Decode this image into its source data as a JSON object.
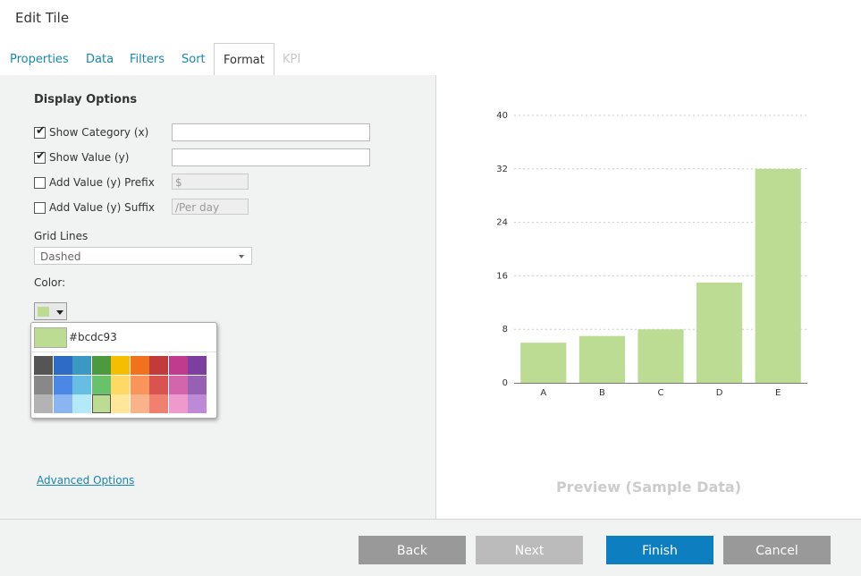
{
  "header": {
    "title": "Edit Tile"
  },
  "tabs": [
    {
      "label": "Properties",
      "state": "normal"
    },
    {
      "label": "Data",
      "state": "normal"
    },
    {
      "label": "Filters",
      "state": "normal"
    },
    {
      "label": "Sort",
      "state": "normal"
    },
    {
      "label": "Format",
      "state": "active"
    },
    {
      "label": "KPI",
      "state": "disabled"
    }
  ],
  "display_options": {
    "title": "Display Options",
    "show_category": {
      "label": "Show Category (x)",
      "checked": true,
      "value": ""
    },
    "show_value": {
      "label": "Show Value (y)",
      "checked": true,
      "value": ""
    },
    "prefix": {
      "label": "Add Value (y) Prefix",
      "checked": false,
      "placeholder": "$"
    },
    "suffix": {
      "label": "Add Value (y) Suffix",
      "checked": false,
      "placeholder": "/Per day"
    },
    "grid_lines_label": "Grid Lines",
    "grid_lines_value": "Dashed",
    "color_label": "Color:",
    "color_value": "#bcdc93",
    "advanced_label": "Advanced Options"
  },
  "palette": [
    [
      "#555555",
      "#2e6bc6",
      "#3a98c1",
      "#4b9a3d",
      "#f6be00",
      "#f2711c",
      "#c23a3a",
      "#c03b8e",
      "#7d3f9f"
    ],
    [
      "#888888",
      "#4d87e6",
      "#66bfe3",
      "#67c26b",
      "#ffd966",
      "#f9945a",
      "#d9534f",
      "#d265ac",
      "#9761b3"
    ],
    [
      "#b3b3b3",
      "#8ab4f2",
      "#b4eaf7",
      "#bcdc93",
      "#ffe699",
      "#f9b38a",
      "#f08070",
      "#ef99cc",
      "#bd8ad8"
    ]
  ],
  "palette_selected": [
    2,
    3
  ],
  "chart_data": {
    "type": "bar",
    "categories": [
      "A",
      "B",
      "C",
      "D",
      "E"
    ],
    "values": [
      6,
      7,
      8,
      15,
      32
    ],
    "ylim": [
      0,
      40
    ],
    "yticks": [
      "0",
      "8",
      "16",
      "24",
      "32",
      "40"
    ],
    "ytick_values": [
      0,
      8,
      16,
      24,
      32,
      40
    ],
    "grid": "dashed",
    "bar_color": "#bcdc93"
  },
  "preview_label": "Preview (Sample Data)",
  "footer": {
    "back": "Back",
    "next": "Next",
    "finish": "Finish",
    "cancel": "Cancel"
  }
}
